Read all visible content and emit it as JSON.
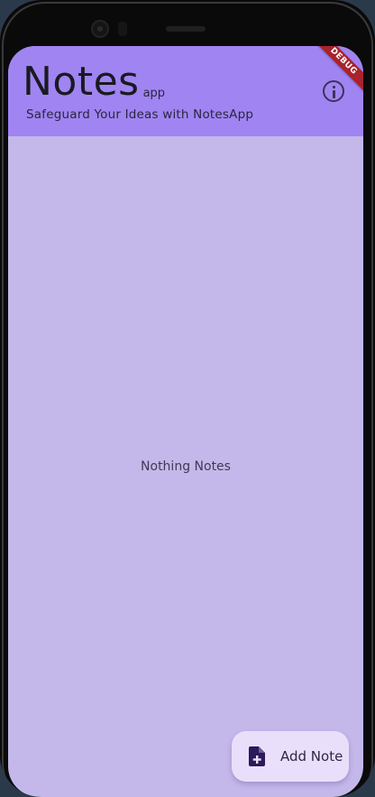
{
  "app_bar": {
    "title": "Notes",
    "title_suffix": "app",
    "subtitle": "Safeguard Your Ideas with NotesApp",
    "info_icon": "info-icon",
    "color": "#a084f2"
  },
  "debug_banner": {
    "label": "DEBUG",
    "color": "#a8232c"
  },
  "content": {
    "empty_message": "Nothing Notes",
    "background": "#c4b8ea"
  },
  "fab": {
    "icon": "note-add-icon",
    "label": "Add Note",
    "background": "#eadffb"
  }
}
